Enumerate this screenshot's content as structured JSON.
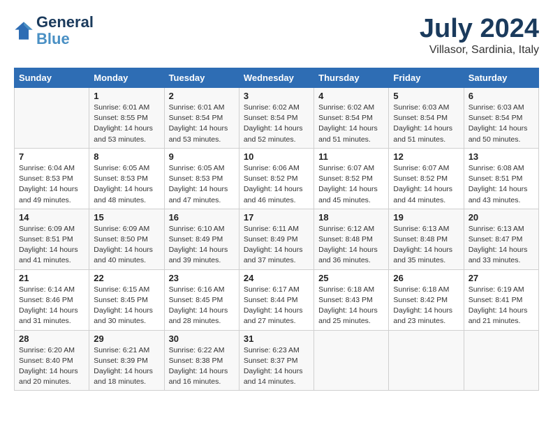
{
  "header": {
    "logo_line1": "General",
    "logo_line2": "Blue",
    "title": "July 2024",
    "subtitle": "Villasor, Sardinia, Italy"
  },
  "calendar": {
    "days_of_week": [
      "Sunday",
      "Monday",
      "Tuesday",
      "Wednesday",
      "Thursday",
      "Friday",
      "Saturday"
    ],
    "weeks": [
      [
        {
          "day": "",
          "info": ""
        },
        {
          "day": "1",
          "info": "Sunrise: 6:01 AM\nSunset: 8:55 PM\nDaylight: 14 hours\nand 53 minutes."
        },
        {
          "day": "2",
          "info": "Sunrise: 6:01 AM\nSunset: 8:54 PM\nDaylight: 14 hours\nand 53 minutes."
        },
        {
          "day": "3",
          "info": "Sunrise: 6:02 AM\nSunset: 8:54 PM\nDaylight: 14 hours\nand 52 minutes."
        },
        {
          "day": "4",
          "info": "Sunrise: 6:02 AM\nSunset: 8:54 PM\nDaylight: 14 hours\nand 51 minutes."
        },
        {
          "day": "5",
          "info": "Sunrise: 6:03 AM\nSunset: 8:54 PM\nDaylight: 14 hours\nand 51 minutes."
        },
        {
          "day": "6",
          "info": "Sunrise: 6:03 AM\nSunset: 8:54 PM\nDaylight: 14 hours\nand 50 minutes."
        }
      ],
      [
        {
          "day": "7",
          "info": "Sunrise: 6:04 AM\nSunset: 8:53 PM\nDaylight: 14 hours\nand 49 minutes."
        },
        {
          "day": "8",
          "info": "Sunrise: 6:05 AM\nSunset: 8:53 PM\nDaylight: 14 hours\nand 48 minutes."
        },
        {
          "day": "9",
          "info": "Sunrise: 6:05 AM\nSunset: 8:53 PM\nDaylight: 14 hours\nand 47 minutes."
        },
        {
          "day": "10",
          "info": "Sunrise: 6:06 AM\nSunset: 8:52 PM\nDaylight: 14 hours\nand 46 minutes."
        },
        {
          "day": "11",
          "info": "Sunrise: 6:07 AM\nSunset: 8:52 PM\nDaylight: 14 hours\nand 45 minutes."
        },
        {
          "day": "12",
          "info": "Sunrise: 6:07 AM\nSunset: 8:52 PM\nDaylight: 14 hours\nand 44 minutes."
        },
        {
          "day": "13",
          "info": "Sunrise: 6:08 AM\nSunset: 8:51 PM\nDaylight: 14 hours\nand 43 minutes."
        }
      ],
      [
        {
          "day": "14",
          "info": "Sunrise: 6:09 AM\nSunset: 8:51 PM\nDaylight: 14 hours\nand 41 minutes."
        },
        {
          "day": "15",
          "info": "Sunrise: 6:09 AM\nSunset: 8:50 PM\nDaylight: 14 hours\nand 40 minutes."
        },
        {
          "day": "16",
          "info": "Sunrise: 6:10 AM\nSunset: 8:49 PM\nDaylight: 14 hours\nand 39 minutes."
        },
        {
          "day": "17",
          "info": "Sunrise: 6:11 AM\nSunset: 8:49 PM\nDaylight: 14 hours\nand 37 minutes."
        },
        {
          "day": "18",
          "info": "Sunrise: 6:12 AM\nSunset: 8:48 PM\nDaylight: 14 hours\nand 36 minutes."
        },
        {
          "day": "19",
          "info": "Sunrise: 6:13 AM\nSunset: 8:48 PM\nDaylight: 14 hours\nand 35 minutes."
        },
        {
          "day": "20",
          "info": "Sunrise: 6:13 AM\nSunset: 8:47 PM\nDaylight: 14 hours\nand 33 minutes."
        }
      ],
      [
        {
          "day": "21",
          "info": "Sunrise: 6:14 AM\nSunset: 8:46 PM\nDaylight: 14 hours\nand 31 minutes."
        },
        {
          "day": "22",
          "info": "Sunrise: 6:15 AM\nSunset: 8:45 PM\nDaylight: 14 hours\nand 30 minutes."
        },
        {
          "day": "23",
          "info": "Sunrise: 6:16 AM\nSunset: 8:45 PM\nDaylight: 14 hours\nand 28 minutes."
        },
        {
          "day": "24",
          "info": "Sunrise: 6:17 AM\nSunset: 8:44 PM\nDaylight: 14 hours\nand 27 minutes."
        },
        {
          "day": "25",
          "info": "Sunrise: 6:18 AM\nSunset: 8:43 PM\nDaylight: 14 hours\nand 25 minutes."
        },
        {
          "day": "26",
          "info": "Sunrise: 6:18 AM\nSunset: 8:42 PM\nDaylight: 14 hours\nand 23 minutes."
        },
        {
          "day": "27",
          "info": "Sunrise: 6:19 AM\nSunset: 8:41 PM\nDaylight: 14 hours\nand 21 minutes."
        }
      ],
      [
        {
          "day": "28",
          "info": "Sunrise: 6:20 AM\nSunset: 8:40 PM\nDaylight: 14 hours\nand 20 minutes."
        },
        {
          "day": "29",
          "info": "Sunrise: 6:21 AM\nSunset: 8:39 PM\nDaylight: 14 hours\nand 18 minutes."
        },
        {
          "day": "30",
          "info": "Sunrise: 6:22 AM\nSunset: 8:38 PM\nDaylight: 14 hours\nand 16 minutes."
        },
        {
          "day": "31",
          "info": "Sunrise: 6:23 AM\nSunset: 8:37 PM\nDaylight: 14 hours\nand 14 minutes."
        },
        {
          "day": "",
          "info": ""
        },
        {
          "day": "",
          "info": ""
        },
        {
          "day": "",
          "info": ""
        }
      ]
    ]
  }
}
